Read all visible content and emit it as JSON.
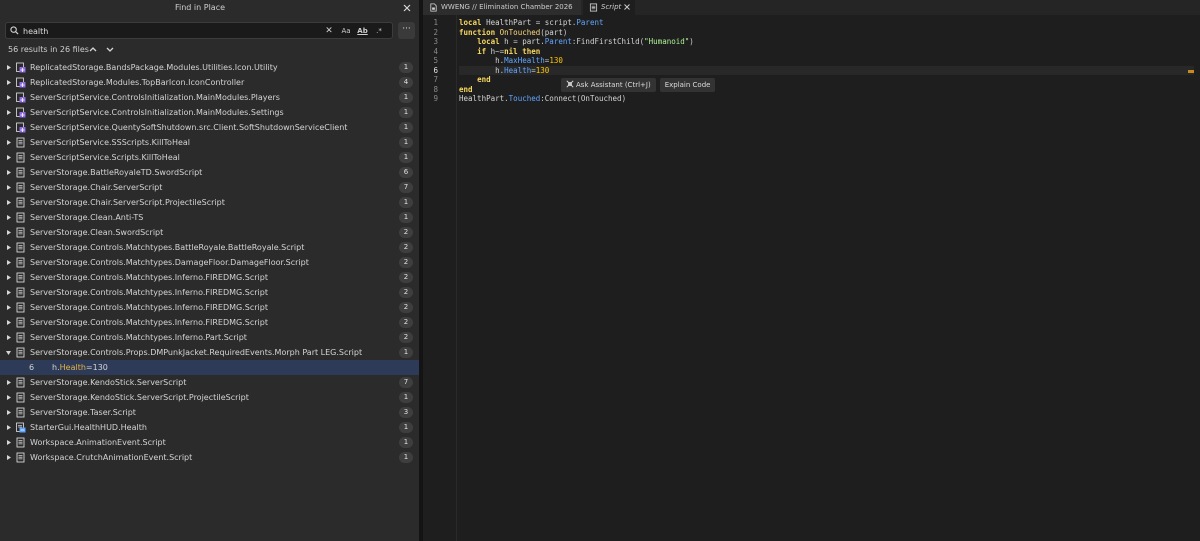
{
  "find_panel": {
    "title": "Find in Place",
    "search": {
      "value": "health",
      "placeholder": ""
    },
    "options": {
      "clear": "✕",
      "match_case": "Aa",
      "whole_word": "Ab",
      "regex": ".*",
      "more": "···"
    },
    "summary": "56 results in 26 files",
    "results": [
      {
        "path": "ReplicatedStorage.BandsPackage.Modules.Utilities.Icon.Utility",
        "count": "1",
        "icon": "module-script-icon"
      },
      {
        "path": "ReplicatedStorage.Modules.TopBarIcon.IconController",
        "count": "4",
        "icon": "module-script-icon"
      },
      {
        "path": "ServerScriptService.ControlsInitialization.MainModules.Players",
        "count": "1",
        "icon": "module-script-icon"
      },
      {
        "path": "ServerScriptService.ControlsInitialization.MainModules.Settings",
        "count": "1",
        "icon": "module-script-icon"
      },
      {
        "path": "ServerScriptService.QuentySoftShutdown.src.Client.SoftShutdownServiceClient",
        "count": "1",
        "icon": "module-script-icon"
      },
      {
        "path": "ServerScriptService.SSScripts.KillToHeal",
        "count": "1",
        "icon": "script-icon"
      },
      {
        "path": "ServerScriptService.Scripts.KillToHeal",
        "count": "1",
        "icon": "script-icon"
      },
      {
        "path": "ServerStorage.BattleRoyaleTD.SwordScript",
        "count": "6",
        "icon": "script-icon"
      },
      {
        "path": "ServerStorage.Chair.ServerScript",
        "count": "7",
        "icon": "script-icon"
      },
      {
        "path": "ServerStorage.Chair.ServerScript.ProjectileScript",
        "count": "1",
        "icon": "script-icon"
      },
      {
        "path": "ServerStorage.Clean.Anti-TS",
        "count": "1",
        "icon": "script-icon"
      },
      {
        "path": "ServerStorage.Clean.SwordScript",
        "count": "2",
        "icon": "script-icon"
      },
      {
        "path": "ServerStorage.Controls.Matchtypes.BattleRoyale.BattleRoyale.Script",
        "count": "2",
        "icon": "script-icon"
      },
      {
        "path": "ServerStorage.Controls.Matchtypes.DamageFloor.DamageFloor.Script",
        "count": "2",
        "icon": "script-icon"
      },
      {
        "path": "ServerStorage.Controls.Matchtypes.Inferno.FIREDMG.Script",
        "count": "2",
        "icon": "script-icon"
      },
      {
        "path": "ServerStorage.Controls.Matchtypes.Inferno.FIREDMG.Script",
        "count": "2",
        "icon": "script-icon"
      },
      {
        "path": "ServerStorage.Controls.Matchtypes.Inferno.FIREDMG.Script",
        "count": "2",
        "icon": "script-icon"
      },
      {
        "path": "ServerStorage.Controls.Matchtypes.Inferno.FIREDMG.Script",
        "count": "2",
        "icon": "script-icon"
      },
      {
        "path": "ServerStorage.Controls.Matchtypes.Inferno.Part.Script",
        "count": "2",
        "icon": "script-icon"
      },
      {
        "path": "ServerStorage.Controls.Props.DMPunkJacket.RequiredEvents.Morph Part LEG.Script",
        "count": "1",
        "icon": "script-icon",
        "expanded": true
      },
      {
        "match": true,
        "line": "6",
        "before": "h.",
        "highlight": "Health",
        "after": "=130"
      },
      {
        "path": "ServerStorage.KendoStick.ServerScript",
        "count": "7",
        "icon": "script-icon"
      },
      {
        "path": "ServerStorage.KendoStick.ServerScript.ProjectileScript",
        "count": "1",
        "icon": "script-icon"
      },
      {
        "path": "ServerStorage.Taser.Script",
        "count": "3",
        "icon": "script-icon"
      },
      {
        "path": "StarterGui.HealthHUD.Health",
        "count": "1",
        "icon": "local-script-icon"
      },
      {
        "path": "Workspace.AnimationEvent.Script",
        "count": "1",
        "icon": "script-icon"
      },
      {
        "path": "Workspace.CrutchAnimationEvent.Script",
        "count": "1",
        "icon": "script-icon"
      }
    ]
  },
  "editor": {
    "tabs": [
      {
        "label": "WWENG // Elimination Chamber 2026",
        "icon": "place-icon"
      },
      {
        "label": "Script",
        "icon": "script-icon"
      }
    ],
    "line_numbers": [
      "1",
      "2",
      "3",
      "4",
      "5",
      "6",
      "7",
      "8",
      "9"
    ],
    "current_line": "6",
    "code": [
      [
        [
          "kw",
          "local"
        ],
        [
          "id",
          " HealthPart "
        ],
        [
          "op",
          "= "
        ],
        [
          "id",
          "script"
        ],
        [
          "op",
          "."
        ],
        [
          "prop",
          "Parent"
        ]
      ],
      [
        [
          "kw",
          "function"
        ],
        [
          "id",
          " "
        ],
        [
          "fn",
          "OnTouched"
        ],
        [
          "op",
          "("
        ],
        [
          "id",
          "part"
        ],
        [
          "op",
          ")"
        ]
      ],
      [
        [
          "id",
          "    "
        ],
        [
          "kw",
          "local"
        ],
        [
          "id",
          " h "
        ],
        [
          "op",
          "= "
        ],
        [
          "id",
          "part"
        ],
        [
          "op",
          "."
        ],
        [
          "prop",
          "Parent"
        ],
        [
          "op",
          ":"
        ],
        [
          "id",
          "FindFirstChild"
        ],
        [
          "op",
          "("
        ],
        [
          "str",
          "\"Humanoid\""
        ],
        [
          "op",
          ")"
        ]
      ],
      [
        [
          "id",
          "    "
        ],
        [
          "kw",
          "if"
        ],
        [
          "id",
          " h"
        ],
        [
          "op",
          "~="
        ],
        [
          "kw",
          "nil"
        ],
        [
          "id",
          " "
        ],
        [
          "kw",
          "then"
        ]
      ],
      [
        [
          "id",
          "        h"
        ],
        [
          "op",
          "."
        ],
        [
          "prop",
          "MaxHealth"
        ],
        [
          "op",
          "="
        ],
        [
          "num",
          "130"
        ]
      ],
      [
        [
          "id",
          "        h"
        ],
        [
          "op",
          "."
        ],
        [
          "prop",
          "Health"
        ],
        [
          "op",
          "="
        ],
        [
          "num",
          "130"
        ]
      ],
      [
        [
          "id",
          "    "
        ],
        [
          "kw",
          "end"
        ]
      ],
      [
        [
          "kw",
          "end"
        ]
      ],
      [
        [
          "id",
          "HealthPart"
        ],
        [
          "op",
          "."
        ],
        [
          "prop",
          "Touched"
        ],
        [
          "op",
          ":"
        ],
        [
          "id",
          "Connect"
        ],
        [
          "op",
          "("
        ],
        [
          "id",
          "OnTouched"
        ],
        [
          "op",
          ")"
        ]
      ]
    ],
    "assistant": {
      "ask_label": "Ask Assistant (Ctrl+J)",
      "explain_label": "Explain Code"
    }
  },
  "colors": {
    "accent_badge": "#3e3e3e",
    "selection": "#2d3a58",
    "module_icon": "#8e6ae6",
    "script_icon": "#d6d6d6",
    "local_script_icon": "#5aa2ff"
  }
}
